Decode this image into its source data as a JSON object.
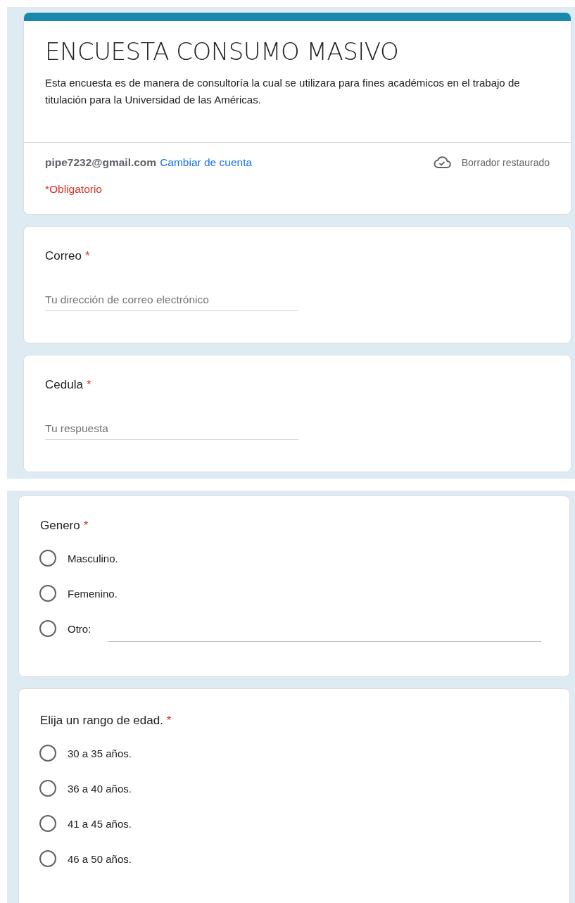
{
  "header": {
    "title": "ENCUESTA CONSUMO MASIVO",
    "description": "Esta encuesta es de manera de consultoría la cual se utilizara para fines académicos en el trabajo de titulación para la Universidad de las Américas.",
    "email": "pipe7232@gmail.com",
    "switch_account": "Cambiar de cuenta",
    "draft_status": "Borrador restaurado",
    "required_note": "*Obligatorio"
  },
  "sections": [
    {
      "questions": [
        {
          "kind": "text",
          "title": "Correo",
          "required_mark": "*",
          "placeholder": "Tu dirección de correo electrónico"
        },
        {
          "kind": "text",
          "title": "Cedula",
          "required_mark": "*",
          "placeholder": "Tu respuesta"
        }
      ]
    },
    {
      "questions": [
        {
          "kind": "radio",
          "title": "Genero",
          "required_mark": "*",
          "options": [
            {
              "kind": "option",
              "label": "Masculino.",
              "selected": false
            },
            {
              "kind": "option",
              "label": "Femenino.",
              "selected": false
            },
            {
              "kind": "other",
              "label": "Otro:",
              "selected": false
            }
          ]
        },
        {
          "kind": "radio",
          "title": "Elija un rango de edad.",
          "required_mark": "*",
          "options": [
            {
              "kind": "option",
              "label": "30 a 35 años.",
              "selected": false
            },
            {
              "kind": "option",
              "label": "36 a 40 años.",
              "selected": false
            },
            {
              "kind": "option",
              "label": "41 a 45 años.",
              "selected": false
            },
            {
              "kind": "option",
              "label": "46 a 50 años.",
              "selected": false
            }
          ]
        }
      ]
    }
  ]
}
